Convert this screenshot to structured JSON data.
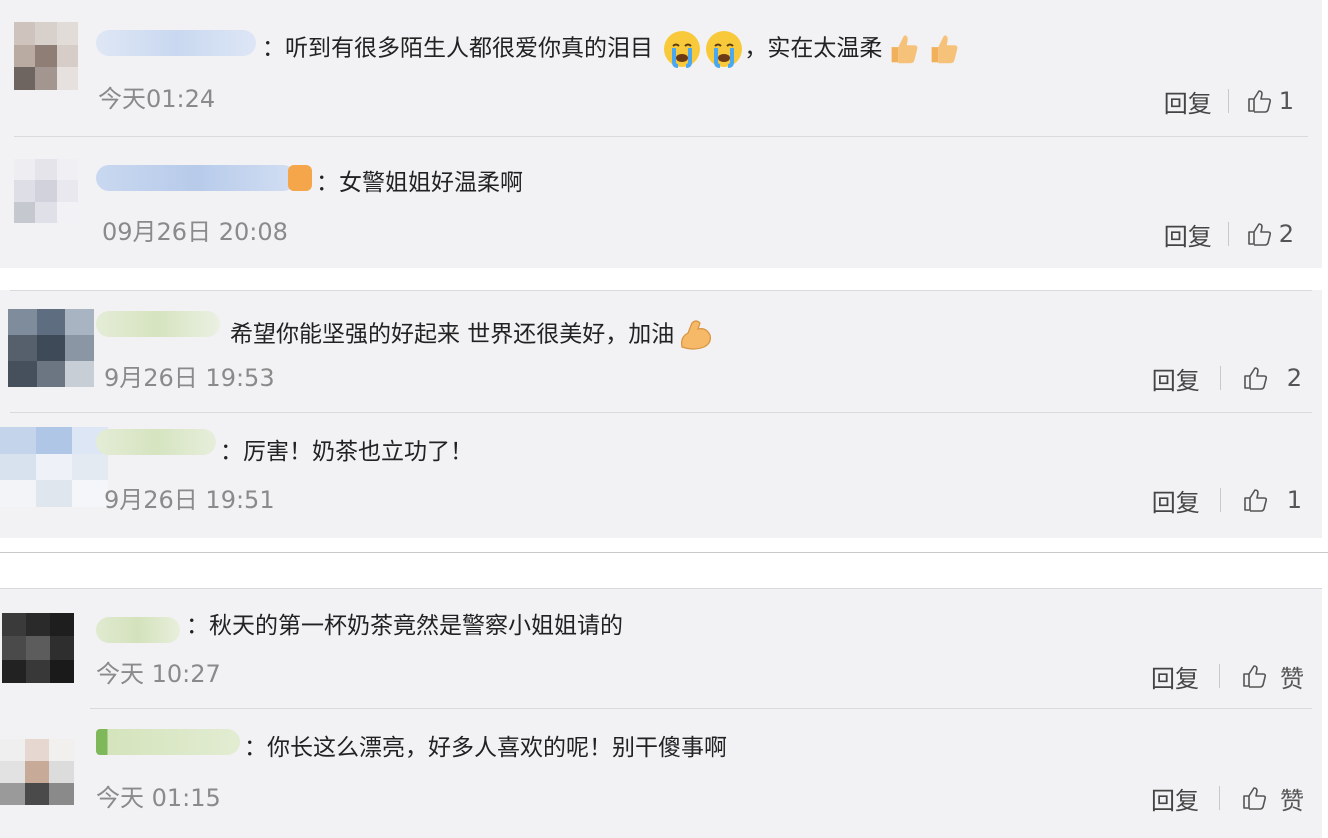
{
  "sections": [
    {
      "comments": [
        {
          "separator": "：",
          "text": "听到有很多陌生人都很爱你真的泪目",
          "emojis_a": [
            "crying-face",
            "crying-face"
          ],
          "text_b": "，实在太温柔",
          "emojis_b": [
            "thumbs-up",
            "thumbs-up"
          ],
          "time": "今天01:24",
          "reply": "回复",
          "likes": "1"
        },
        {
          "separator": "：",
          "text": "女警姐姐好温柔啊",
          "time": "09月26日 20:08",
          "reply": "回复",
          "likes": "2"
        }
      ]
    },
    {
      "comments": [
        {
          "text": "希望你能坚强的好起来 世界还很美好，加油",
          "emojis": [
            "flexed-biceps"
          ],
          "time": "9月26日 19:53",
          "reply": "回复",
          "likes": "2"
        },
        {
          "separator": "：",
          "text": "厉害！奶茶也立功了！",
          "time": "9月26日 19:51",
          "reply": "回复",
          "likes": "1"
        }
      ]
    },
    {
      "comments": [
        {
          "separator": "：",
          "text": "秋天的第一杯奶茶竟然是警察小姐姐请的",
          "time": "今天 10:27",
          "reply": "回复",
          "likes": "赞"
        },
        {
          "separator": "：",
          "text": "你长这么漂亮，好多人喜欢的呢！别干傻事啊",
          "time": "今天 01:15",
          "reply": "回复",
          "likes": "赞"
        }
      ]
    }
  ],
  "colors": {
    "panel_bg": "#f2f2f5",
    "divider": "#d9d9de",
    "time_text": "#8a8a8a",
    "body_text": "#222222"
  }
}
